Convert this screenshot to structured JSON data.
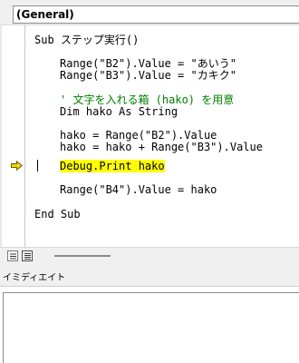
{
  "object_combo": {
    "value": "(General)"
  },
  "code": {
    "lines": [
      "Sub ステップ実行()",
      "Range(\"B2\").Value = \"あいう\"",
      "Range(\"B3\").Value = \"カキク\"",
      "' 文字を入れる箱 (hako) を用意",
      "Dim hako As String",
      "hako = Range(\"B2\").Value",
      "hako = hako + Range(\"B3\").Value",
      "Debug.Print hako",
      "Range(\"B4\").Value = hako",
      "End Sub"
    ],
    "current_line_index": 7,
    "colors": {
      "comment": "#008000",
      "execution_highlight": "#ffff00",
      "arrow": "#f5d800"
    }
  },
  "immediate": {
    "title": "イミディエイト",
    "content": ""
  }
}
